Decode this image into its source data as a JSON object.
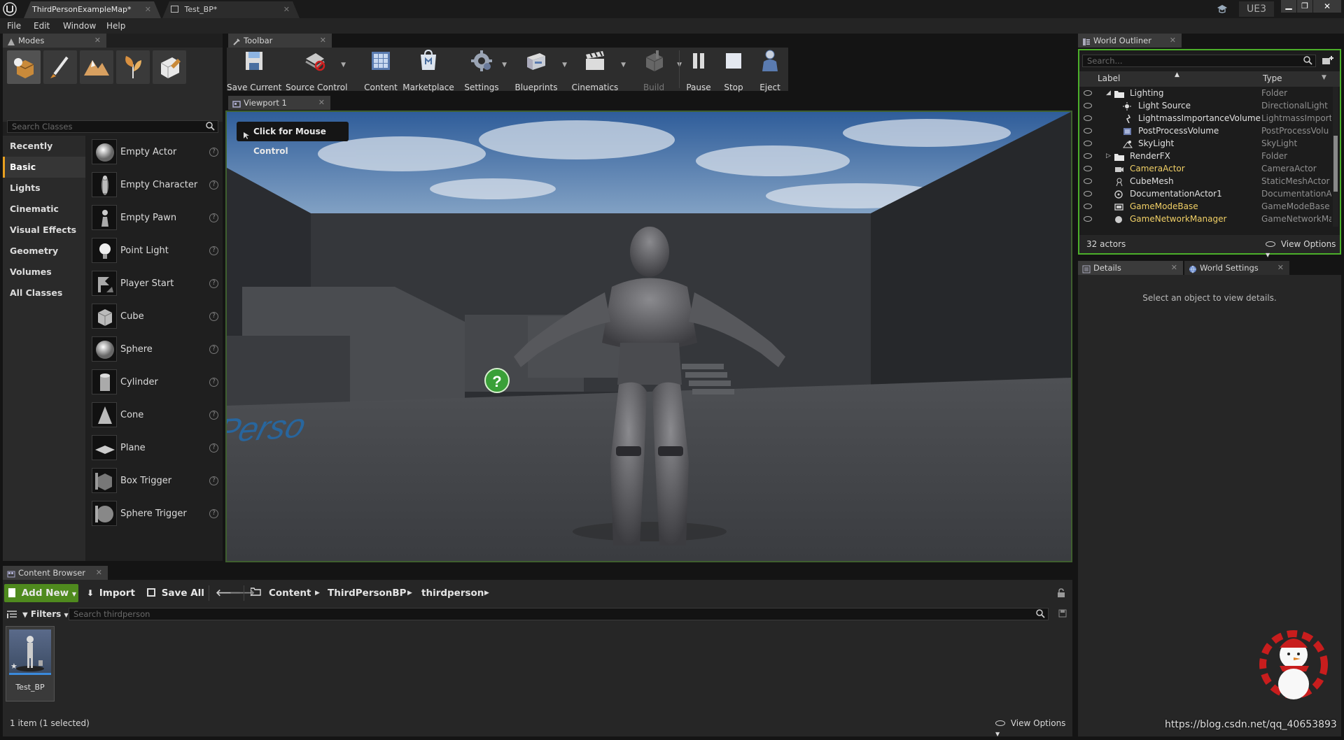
{
  "title_bar": {
    "tabs": [
      {
        "label": "ThirdPersonExampleMap*"
      },
      {
        "label": "Test_BP*"
      }
    ],
    "project_name": "UE3",
    "window_controls": [
      "minimize-icon",
      "restore-icon",
      "close-icon"
    ]
  },
  "menu": {
    "items": [
      "File",
      "Edit",
      "Window",
      "Help"
    ]
  },
  "modes": {
    "tab_label": "Modes",
    "search_placeholder": "Search Classes",
    "categories": [
      {
        "label": "Recently Placed",
        "selected": false
      },
      {
        "label": "Basic",
        "selected": true
      },
      {
        "label": "Lights",
        "selected": false
      },
      {
        "label": "Cinematic",
        "selected": false
      },
      {
        "label": "Visual Effects",
        "selected": false
      },
      {
        "label": "Geometry",
        "selected": false
      },
      {
        "label": "Volumes",
        "selected": false
      },
      {
        "label": "All Classes",
        "selected": false
      }
    ],
    "items": [
      {
        "label": "Empty Actor",
        "icon": "sphere-icon"
      },
      {
        "label": "Empty Character",
        "icon": "character-icon"
      },
      {
        "label": "Empty Pawn",
        "icon": "pawn-icon"
      },
      {
        "label": "Point Light",
        "icon": "light-bulb-icon"
      },
      {
        "label": "Player Start",
        "icon": "player-start-icon"
      },
      {
        "label": "Cube",
        "icon": "cube-icon"
      },
      {
        "label": "Sphere",
        "icon": "sphere-icon"
      },
      {
        "label": "Cylinder",
        "icon": "cylinder-icon"
      },
      {
        "label": "Cone",
        "icon": "cone-icon"
      },
      {
        "label": "Plane",
        "icon": "plane-icon"
      },
      {
        "label": "Box Trigger",
        "icon": "box-trigger-icon"
      },
      {
        "label": "Sphere Trigger",
        "icon": "sphere-trigger-icon"
      }
    ]
  },
  "toolbar": {
    "tab_label": "Toolbar",
    "buttons": [
      {
        "label": "Save Current",
        "icon": "save-icon",
        "dropdown": false
      },
      {
        "label": "Source Control",
        "icon": "source-control-icon",
        "dropdown": true
      },
      {
        "label": "Content",
        "icon": "content-icon",
        "dropdown": false
      },
      {
        "label": "Marketplace",
        "icon": "marketplace-icon",
        "dropdown": false
      },
      {
        "label": "Settings",
        "icon": "settings-icon",
        "dropdown": true
      },
      {
        "label": "Blueprints",
        "icon": "blueprints-icon",
        "dropdown": true
      },
      {
        "label": "Cinematics",
        "icon": "cinematics-icon",
        "dropdown": true
      },
      {
        "label": "Build",
        "icon": "build-icon",
        "dropdown": true
      },
      {
        "label": "Pause",
        "icon": "pause-icon",
        "dropdown": false
      },
      {
        "label": "Stop",
        "icon": "stop-icon",
        "dropdown": false
      },
      {
        "label": "Eject",
        "icon": "eject-icon",
        "dropdown": false
      }
    ]
  },
  "viewport": {
    "tab_label": "Viewport 1",
    "mouse_control_label": "Click for Mouse Control",
    "floor_text": "Third Perso"
  },
  "outliner": {
    "tab_label": "World Outliner",
    "search_placeholder": "Search...",
    "col_label": "Label",
    "col_type": "Type",
    "rows": [
      {
        "label": "Lighting",
        "type": "Folder",
        "highlight": false,
        "indent": 1,
        "icon": "folder-icon",
        "expander": "expanded"
      },
      {
        "label": "Light Source",
        "type": "DirectionalLight",
        "highlight": false,
        "indent": 2,
        "icon": "directional-light-icon",
        "expander": ""
      },
      {
        "label": "LightmassImportanceVolume",
        "type": "LightmassImporta",
        "highlight": false,
        "indent": 2,
        "icon": "volume-icon",
        "expander": ""
      },
      {
        "label": "PostProcessVolume",
        "type": "PostProcessVolu",
        "highlight": false,
        "indent": 2,
        "icon": "postprocess-icon",
        "expander": ""
      },
      {
        "label": "SkyLight",
        "type": "SkyLight",
        "highlight": false,
        "indent": 2,
        "icon": "skylight-icon",
        "expander": ""
      },
      {
        "label": "RenderFX",
        "type": "Folder",
        "highlight": false,
        "indent": 1,
        "icon": "folder-icon",
        "expander": "collapsed"
      },
      {
        "label": "CameraActor",
        "type": "CameraActor",
        "highlight": true,
        "indent": 1,
        "icon": "camera-icon",
        "expander": ""
      },
      {
        "label": "CubeMesh",
        "type": "StaticMeshActor",
        "highlight": false,
        "indent": 1,
        "icon": "mesh-icon",
        "expander": ""
      },
      {
        "label": "DocumentationActor1",
        "type": "DocumentationAc",
        "highlight": false,
        "indent": 1,
        "icon": "documentation-icon",
        "expander": ""
      },
      {
        "label": "GameModeBase",
        "type": "GameModeBase",
        "highlight": true,
        "indent": 1,
        "icon": "gamemode-icon",
        "expander": ""
      },
      {
        "label": "GameNetworkManager",
        "type": "GameNetworkMar",
        "highlight": true,
        "indent": 1,
        "icon": "network-icon",
        "expander": ""
      }
    ],
    "actor_count": "32 actors",
    "view_options": "View Options"
  },
  "details": {
    "tab_label": "Details",
    "world_settings_tab": "World Settings",
    "empty_message": "Select an object to view details."
  },
  "content_browser": {
    "tab_label": "Content Browser",
    "add_new": "Add New",
    "import": "Import",
    "save_all": "Save All",
    "breadcrumb": [
      "Content",
      "ThirdPersonBP",
      "thirdperson"
    ],
    "filters": "Filters",
    "search_placeholder": "Search thirdperson",
    "assets": [
      {
        "label": "Test_BP"
      }
    ],
    "status": "1 item (1 selected)",
    "view_options": "View Options"
  },
  "watermark": "https://blog.csdn.net/qq_40653893",
  "colors": {
    "accent_orange": "#e8a020",
    "highlight_yellow": "#f1d066",
    "add_new_green": "#4f8a1e",
    "outliner_border": "#4caf2a"
  }
}
